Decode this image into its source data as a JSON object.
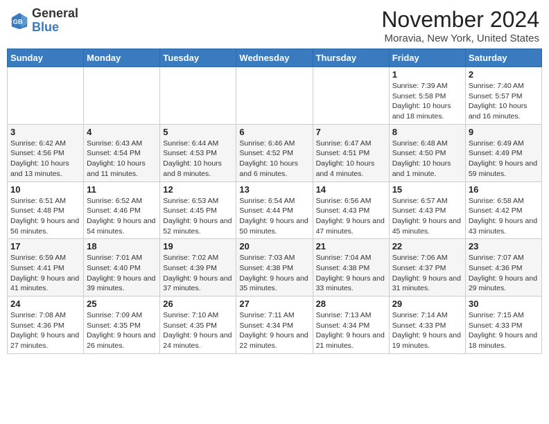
{
  "header": {
    "logo_line1": "General",
    "logo_line2": "Blue",
    "month_title": "November 2024",
    "location": "Moravia, New York, United States"
  },
  "days_of_week": [
    "Sunday",
    "Monday",
    "Tuesday",
    "Wednesday",
    "Thursday",
    "Friday",
    "Saturday"
  ],
  "weeks": [
    [
      {
        "day": "",
        "info": ""
      },
      {
        "day": "",
        "info": ""
      },
      {
        "day": "",
        "info": ""
      },
      {
        "day": "",
        "info": ""
      },
      {
        "day": "",
        "info": ""
      },
      {
        "day": "1",
        "info": "Sunrise: 7:39 AM\nSunset: 5:58 PM\nDaylight: 10 hours and 18 minutes."
      },
      {
        "day": "2",
        "info": "Sunrise: 7:40 AM\nSunset: 5:57 PM\nDaylight: 10 hours and 16 minutes."
      }
    ],
    [
      {
        "day": "3",
        "info": "Sunrise: 6:42 AM\nSunset: 4:56 PM\nDaylight: 10 hours and 13 minutes."
      },
      {
        "day": "4",
        "info": "Sunrise: 6:43 AM\nSunset: 4:54 PM\nDaylight: 10 hours and 11 minutes."
      },
      {
        "day": "5",
        "info": "Sunrise: 6:44 AM\nSunset: 4:53 PM\nDaylight: 10 hours and 8 minutes."
      },
      {
        "day": "6",
        "info": "Sunrise: 6:46 AM\nSunset: 4:52 PM\nDaylight: 10 hours and 6 minutes."
      },
      {
        "day": "7",
        "info": "Sunrise: 6:47 AM\nSunset: 4:51 PM\nDaylight: 10 hours and 4 minutes."
      },
      {
        "day": "8",
        "info": "Sunrise: 6:48 AM\nSunset: 4:50 PM\nDaylight: 10 hours and 1 minute."
      },
      {
        "day": "9",
        "info": "Sunrise: 6:49 AM\nSunset: 4:49 PM\nDaylight: 9 hours and 59 minutes."
      }
    ],
    [
      {
        "day": "10",
        "info": "Sunrise: 6:51 AM\nSunset: 4:48 PM\nDaylight: 9 hours and 56 minutes."
      },
      {
        "day": "11",
        "info": "Sunrise: 6:52 AM\nSunset: 4:46 PM\nDaylight: 9 hours and 54 minutes."
      },
      {
        "day": "12",
        "info": "Sunrise: 6:53 AM\nSunset: 4:45 PM\nDaylight: 9 hours and 52 minutes."
      },
      {
        "day": "13",
        "info": "Sunrise: 6:54 AM\nSunset: 4:44 PM\nDaylight: 9 hours and 50 minutes."
      },
      {
        "day": "14",
        "info": "Sunrise: 6:56 AM\nSunset: 4:43 PM\nDaylight: 9 hours and 47 minutes."
      },
      {
        "day": "15",
        "info": "Sunrise: 6:57 AM\nSunset: 4:43 PM\nDaylight: 9 hours and 45 minutes."
      },
      {
        "day": "16",
        "info": "Sunrise: 6:58 AM\nSunset: 4:42 PM\nDaylight: 9 hours and 43 minutes."
      }
    ],
    [
      {
        "day": "17",
        "info": "Sunrise: 6:59 AM\nSunset: 4:41 PM\nDaylight: 9 hours and 41 minutes."
      },
      {
        "day": "18",
        "info": "Sunrise: 7:01 AM\nSunset: 4:40 PM\nDaylight: 9 hours and 39 minutes."
      },
      {
        "day": "19",
        "info": "Sunrise: 7:02 AM\nSunset: 4:39 PM\nDaylight: 9 hours and 37 minutes."
      },
      {
        "day": "20",
        "info": "Sunrise: 7:03 AM\nSunset: 4:38 PM\nDaylight: 9 hours and 35 minutes."
      },
      {
        "day": "21",
        "info": "Sunrise: 7:04 AM\nSunset: 4:38 PM\nDaylight: 9 hours and 33 minutes."
      },
      {
        "day": "22",
        "info": "Sunrise: 7:06 AM\nSunset: 4:37 PM\nDaylight: 9 hours and 31 minutes."
      },
      {
        "day": "23",
        "info": "Sunrise: 7:07 AM\nSunset: 4:36 PM\nDaylight: 9 hours and 29 minutes."
      }
    ],
    [
      {
        "day": "24",
        "info": "Sunrise: 7:08 AM\nSunset: 4:36 PM\nDaylight: 9 hours and 27 minutes."
      },
      {
        "day": "25",
        "info": "Sunrise: 7:09 AM\nSunset: 4:35 PM\nDaylight: 9 hours and 26 minutes."
      },
      {
        "day": "26",
        "info": "Sunrise: 7:10 AM\nSunset: 4:35 PM\nDaylight: 9 hours and 24 minutes."
      },
      {
        "day": "27",
        "info": "Sunrise: 7:11 AM\nSunset: 4:34 PM\nDaylight: 9 hours and 22 minutes."
      },
      {
        "day": "28",
        "info": "Sunrise: 7:13 AM\nSunset: 4:34 PM\nDaylight: 9 hours and 21 minutes."
      },
      {
        "day": "29",
        "info": "Sunrise: 7:14 AM\nSunset: 4:33 PM\nDaylight: 9 hours and 19 minutes."
      },
      {
        "day": "30",
        "info": "Sunrise: 7:15 AM\nSunset: 4:33 PM\nDaylight: 9 hours and 18 minutes."
      }
    ]
  ]
}
